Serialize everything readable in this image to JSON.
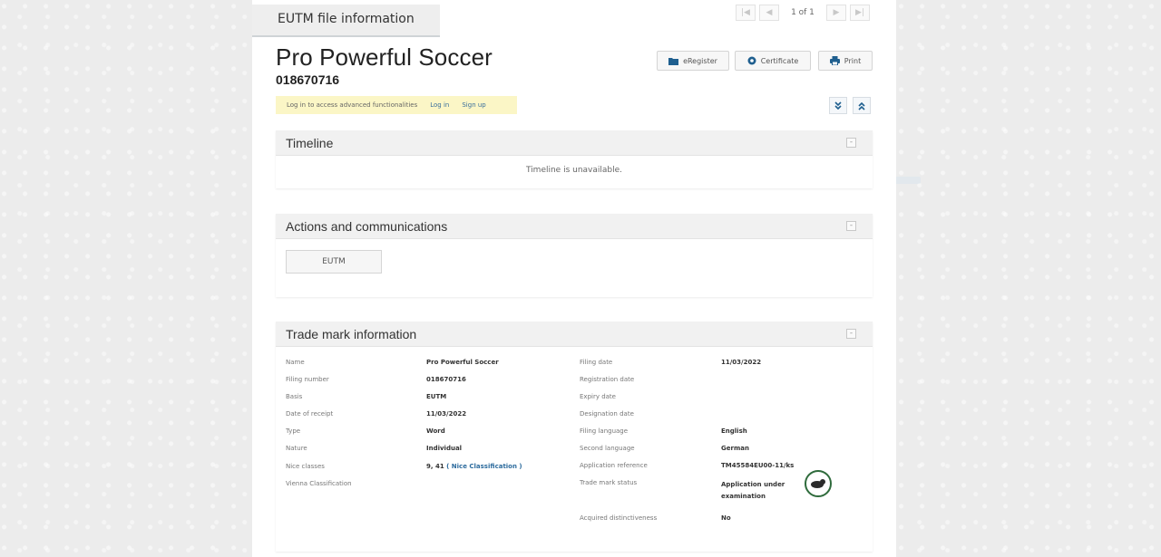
{
  "tab": {
    "label": "EUTM file information"
  },
  "pager": {
    "text": "1 of 1",
    "first": "|◀",
    "prev": "◀",
    "next": "▶",
    "last": "▶|"
  },
  "header": {
    "title": "Pro Powerful Soccer",
    "number": "018670716"
  },
  "toolbar": {
    "eregister_label": "eRegister",
    "certificate_label": "Certificate",
    "print_label": "Print",
    "icons": [
      "folder-icon",
      "certificate-icon",
      "printer-icon"
    ]
  },
  "login_bar": {
    "message": "Log in to access advanced functionalities",
    "login_link": "Log in",
    "signup_link": "Sign up"
  },
  "timeline": {
    "title": "Timeline",
    "message": "Timeline is unavailable."
  },
  "actions": {
    "title": "Actions and communications",
    "button_label": "EUTM"
  },
  "trademark": {
    "title": "Trade mark information",
    "left": [
      {
        "label": "Name",
        "value": "Pro Powerful Soccer"
      },
      {
        "label": "Filing number",
        "value": "018670716"
      },
      {
        "label": "Basis",
        "value": "EUTM"
      },
      {
        "label": "Date of receipt",
        "value": "11/03/2022"
      },
      {
        "label": "Type",
        "value": "Word"
      },
      {
        "label": "Nature",
        "value": "Individual"
      },
      {
        "label": "Nice classes",
        "value": "9, 41",
        "link": "( Nice Classification )"
      },
      {
        "label": "Vienna Classification",
        "value": ""
      }
    ],
    "right": [
      {
        "label": "Filing date",
        "value": "11/03/2022"
      },
      {
        "label": "Registration date",
        "value": ""
      },
      {
        "label": "Expiry date",
        "value": ""
      },
      {
        "label": "Designation date",
        "value": ""
      },
      {
        "label": "Filing language",
        "value": "English"
      },
      {
        "label": "Second language",
        "value": "German"
      },
      {
        "label": "Application reference",
        "value": "TM45584EU00-11/ks"
      },
      {
        "label": "Trade mark status",
        "value": "Application under examination"
      },
      {
        "label": "Acquired distinctiveness",
        "value": "No"
      }
    ],
    "status_icon": "examination-status-icon",
    "status_color": "#2f6b3c"
  }
}
